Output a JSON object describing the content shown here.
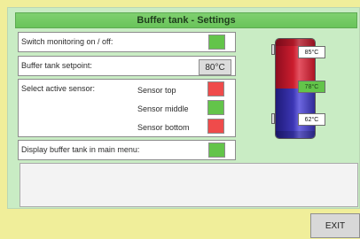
{
  "title": "Buffer tank - Settings",
  "rows": {
    "monitoring": {
      "label": "Switch monitoring on / off:"
    },
    "setpoint": {
      "label": "Buffer tank setpoint:",
      "value": "80°C"
    },
    "sensor": {
      "label": "Select active sensor:",
      "top": "Sensor top",
      "middle": "Sensor middle",
      "bottom": "Sensor bottom"
    },
    "display": {
      "label": "Display buffer tank in main menu:"
    }
  },
  "tank": {
    "top": "85°C",
    "middle": "78°C",
    "bottom": "62°C"
  },
  "footer": {
    "exit": "EXIT"
  },
  "colors": {
    "background": "#f0ee9a",
    "panel": "#c9ecc4",
    "title": "#6fc861",
    "active_green": "#63c44a",
    "inactive_red": "#ef4b4b"
  }
}
